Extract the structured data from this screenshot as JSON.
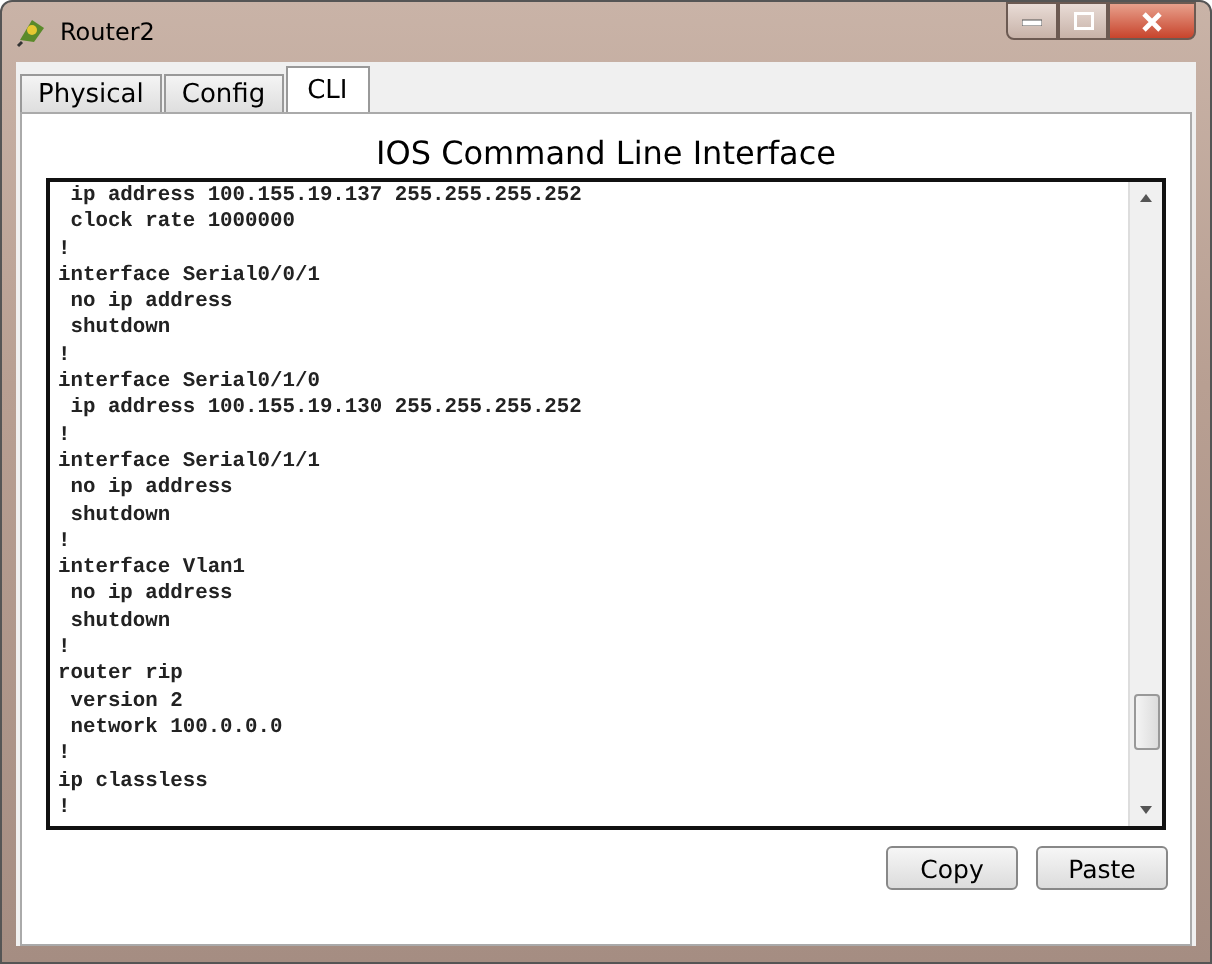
{
  "window": {
    "title": "Router2"
  },
  "tabs": [
    {
      "label": "Physical",
      "selected": false
    },
    {
      "label": "Config",
      "selected": false
    },
    {
      "label": "CLI",
      "selected": true
    }
  ],
  "heading": "IOS Command Line Interface",
  "console_lines": [
    " ip address 100.155.19.137 255.255.255.252",
    " clock rate 1000000",
    "!",
    "interface Serial0/0/1",
    " no ip address",
    " shutdown",
    "!",
    "interface Serial0/1/0",
    " ip address 100.155.19.130 255.255.255.252",
    "!",
    "interface Serial0/1/1",
    " no ip address",
    " shutdown",
    "!",
    "interface Vlan1",
    " no ip address",
    " shutdown",
    "!",
    "router rip",
    " version 2",
    " network 100.0.0.0",
    "!",
    "ip classless",
    "!"
  ],
  "buttons": [
    "Copy",
    "Paste"
  ]
}
